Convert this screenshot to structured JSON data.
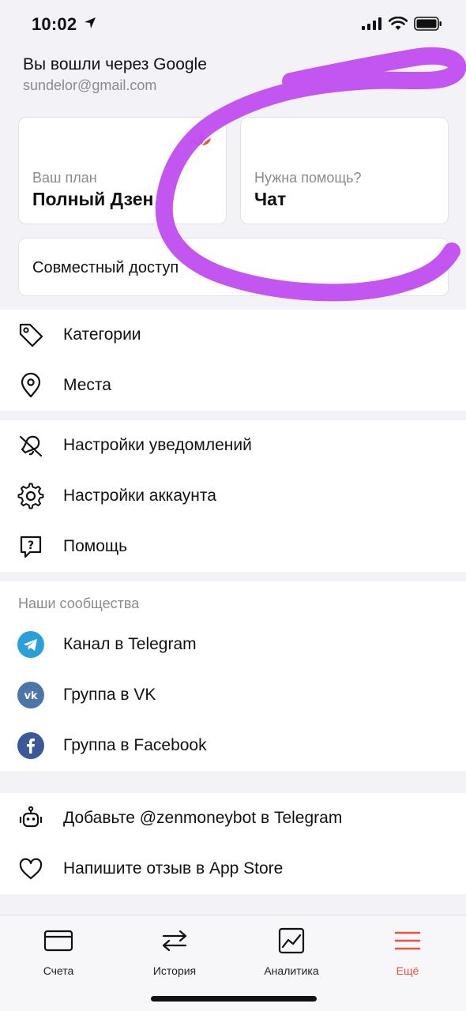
{
  "status_bar": {
    "time": "10:02"
  },
  "account": {
    "title": "Вы вошли через Google",
    "email": "sundelor@gmail.com"
  },
  "cards": {
    "plan": {
      "label": "Ваш план",
      "value": "Полный Дзен"
    },
    "help": {
      "label": "Нужна помощь?",
      "value": "Чат"
    },
    "share": {
      "label": "Совместный доступ"
    }
  },
  "menu_1": [
    {
      "label": "Категории",
      "icon": "tag-icon"
    },
    {
      "label": "Места",
      "icon": "location-pin-icon"
    }
  ],
  "menu_2": [
    {
      "label": "Настройки уведомлений",
      "icon": "bell-off-icon"
    },
    {
      "label": "Настройки аккаунта",
      "icon": "gear-icon"
    },
    {
      "label": "Помощь",
      "icon": "help-bubble-icon"
    }
  ],
  "communities": {
    "header": "Наши сообщества",
    "items": [
      {
        "label": "Канал в Telegram",
        "icon": "telegram-icon",
        "color": "#2aa0da"
      },
      {
        "label": "Группа в VK",
        "icon": "vk-icon",
        "color": "#4a76a8"
      },
      {
        "label": "Группа в Facebook",
        "icon": "facebook-icon",
        "color": "#3b5998"
      }
    ]
  },
  "menu_3": [
    {
      "label": "Добавьте @zenmoneybot в Telegram",
      "icon": "robot-icon"
    },
    {
      "label": "Напишите отзыв в App Store",
      "icon": "heart-icon"
    }
  ],
  "tabbar": [
    {
      "label": "Счета",
      "icon": "card-icon"
    },
    {
      "label": "История",
      "icon": "swap-arrows-icon"
    },
    {
      "label": "Аналитика",
      "icon": "chart-icon"
    },
    {
      "label": "Ещё",
      "icon": "menu-icon",
      "active": true
    }
  ],
  "colors": {
    "accent": "#e8543f",
    "annotation": "#c04df0",
    "background": "#f3f3f7"
  }
}
